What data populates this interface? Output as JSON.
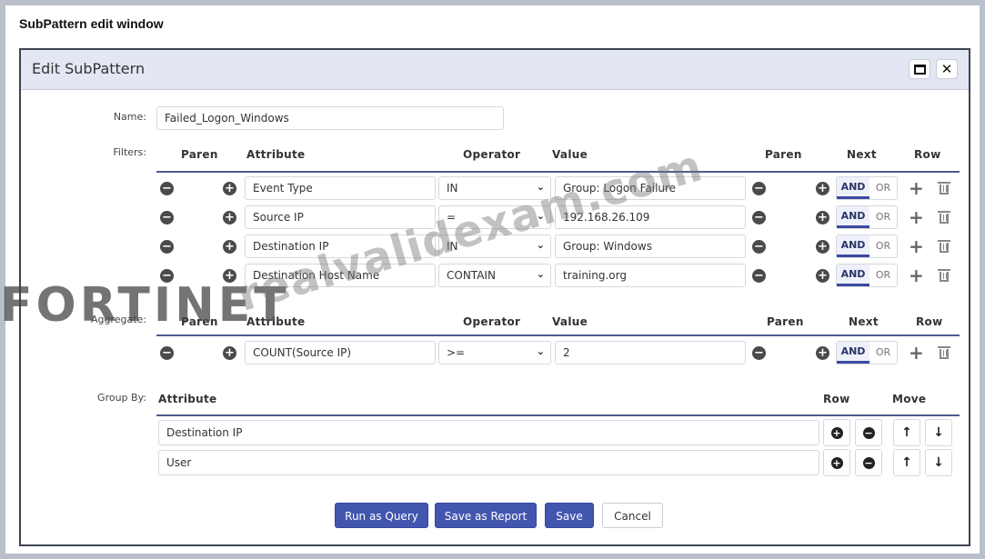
{
  "caption": "SubPattern edit window",
  "dialog": {
    "title": "Edit SubPattern",
    "maximize_icon": "maximize-icon",
    "close_icon": "close-icon",
    "close_glyph": "✕"
  },
  "name": {
    "label": "Name:",
    "value": "Failed_Logon_Windows"
  },
  "filters": {
    "label": "Filters:",
    "headers": {
      "paren_open": "Paren",
      "attribute": "Attribute",
      "operator": "Operator",
      "value": "Value",
      "paren_close": "Paren",
      "next": "Next",
      "row": "Row"
    },
    "rows": [
      {
        "attribute": "Event Type",
        "operator": "IN",
        "value": "Group: Logon Failure",
        "next_and": "AND",
        "next_or": "OR"
      },
      {
        "attribute": "Source IP",
        "operator": "=",
        "value": "192.168.26.109",
        "next_and": "AND",
        "next_or": "OR"
      },
      {
        "attribute": "Destination IP",
        "operator": "IN",
        "value": "Group: Windows",
        "next_and": "AND",
        "next_or": "OR"
      },
      {
        "attribute": "Destination Host Name",
        "operator": "CONTAIN",
        "value": "training.org",
        "next_and": "AND",
        "next_or": "OR"
      }
    ]
  },
  "aggregate": {
    "label": "Aggregate:",
    "headers": {
      "paren_open": "Paren",
      "attribute": "Attribute",
      "operator": "Operator",
      "value": "Value",
      "paren_close": "Paren",
      "next": "Next",
      "row": "Row"
    },
    "rows": [
      {
        "attribute": "COUNT(Source IP)",
        "operator": ">=",
        "value": "2",
        "next_and": "AND",
        "next_or": "OR"
      }
    ]
  },
  "group_by": {
    "label": "Group By:",
    "headers": {
      "attribute": "Attribute",
      "row": "Row",
      "move": "Move"
    },
    "rows": [
      {
        "attribute": "Destination IP"
      },
      {
        "attribute": "User"
      }
    ]
  },
  "buttons": {
    "run_query": "Run as Query",
    "save_report": "Save as Report",
    "save": "Save",
    "cancel": "Cancel"
  },
  "watermarks": {
    "logo": "FORTINET",
    "site": "realvalidexam.com"
  },
  "colors": {
    "primary": "#4256b0",
    "header_bg": "#e3e7f4",
    "divider": "#4d5b8c"
  }
}
